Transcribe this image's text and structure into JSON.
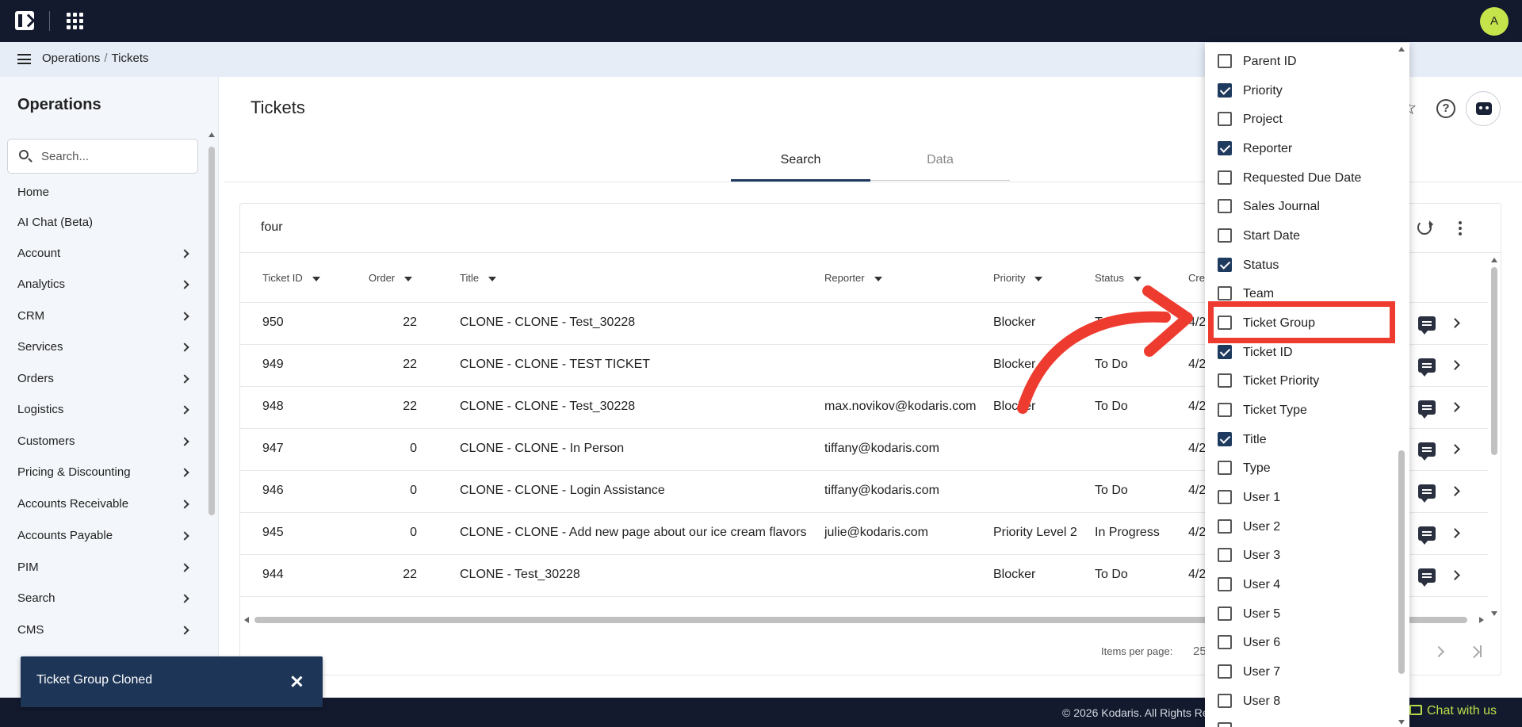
{
  "topbar": {
    "avatar_initial": "A"
  },
  "breadcrumb": {
    "section": "Operations",
    "separator": "/",
    "page": "Tickets"
  },
  "sidebar": {
    "title": "Operations",
    "search_placeholder": "Search...",
    "items": [
      {
        "label": "Home",
        "has_children": false
      },
      {
        "label": "AI Chat (Beta)",
        "has_children": false
      },
      {
        "label": "Account",
        "has_children": true
      },
      {
        "label": "Analytics",
        "has_children": true
      },
      {
        "label": "CRM",
        "has_children": true
      },
      {
        "label": "Services",
        "has_children": true
      },
      {
        "label": "Orders",
        "has_children": true
      },
      {
        "label": "Logistics",
        "has_children": true
      },
      {
        "label": "Customers",
        "has_children": true
      },
      {
        "label": "Pricing & Discounting",
        "has_children": true
      },
      {
        "label": "Accounts Receivable",
        "has_children": true
      },
      {
        "label": "Accounts Payable",
        "has_children": true
      },
      {
        "label": "PIM",
        "has_children": true
      },
      {
        "label": "Search",
        "has_children": true
      },
      {
        "label": "CMS",
        "has_children": true
      }
    ]
  },
  "main": {
    "title": "Tickets",
    "tabs": [
      {
        "label": "Search",
        "active": true
      },
      {
        "label": "Data",
        "active": false
      }
    ],
    "help_glyph": "?",
    "search_value": "four"
  },
  "table": {
    "columns": [
      {
        "label": "Ticket ID"
      },
      {
        "label": "Order"
      },
      {
        "label": "Title"
      },
      {
        "label": "Reporter"
      },
      {
        "label": "Priority"
      },
      {
        "label": "Status"
      },
      {
        "label": "Cre"
      }
    ],
    "rows": [
      {
        "ticket_id": "950",
        "order": "22",
        "title": "CLONE - CLONE - Test_30228",
        "reporter": "",
        "priority": "Blocker",
        "status": "To",
        "created": "4/2"
      },
      {
        "ticket_id": "949",
        "order": "22",
        "title": "CLONE - CLONE - TEST TICKET",
        "reporter": "",
        "priority": "Blocker",
        "status": "To Do",
        "created": "4/2"
      },
      {
        "ticket_id": "948",
        "order": "22",
        "title": "CLONE - CLONE - Test_30228",
        "reporter": "max.novikov@kodaris.com",
        "priority": "Blocker",
        "status": "To Do",
        "created": "4/2"
      },
      {
        "ticket_id": "947",
        "order": "0",
        "title": "CLONE - CLONE - In Person",
        "reporter": "tiffany@kodaris.com",
        "priority": "",
        "status": "",
        "created": "4/2"
      },
      {
        "ticket_id": "946",
        "order": "0",
        "title": "CLONE - CLONE - Login Assistance",
        "reporter": "tiffany@kodaris.com",
        "priority": "",
        "status": "To Do",
        "created": "4/2"
      },
      {
        "ticket_id": "945",
        "order": "0",
        "title": "CLONE - CLONE - Add new page about our ice cream flavors",
        "reporter": "julie@kodaris.com",
        "priority": "Priority Level 2",
        "status": "In Progress",
        "created": "4/2"
      },
      {
        "ticket_id": "944",
        "order": "22",
        "title": "CLONE - Test_30228",
        "reporter": "",
        "priority": "Blocker",
        "status": "To Do",
        "created": "4/2"
      }
    ]
  },
  "pagination": {
    "items_per_page_label": "Items per page:",
    "items_per_page_value": "25"
  },
  "column_picker": {
    "options": [
      {
        "label": "Parent ID",
        "checked": false
      },
      {
        "label": "Priority",
        "checked": true
      },
      {
        "label": "Project",
        "checked": false
      },
      {
        "label": "Reporter",
        "checked": true
      },
      {
        "label": "Requested Due Date",
        "checked": false
      },
      {
        "label": "Sales Journal",
        "checked": false
      },
      {
        "label": "Start Date",
        "checked": false
      },
      {
        "label": "Status",
        "checked": true
      },
      {
        "label": "Team",
        "checked": false
      },
      {
        "label": "Ticket Group",
        "checked": false
      },
      {
        "label": "Ticket ID",
        "checked": true
      },
      {
        "label": "Ticket Priority",
        "checked": false
      },
      {
        "label": "Ticket Type",
        "checked": false
      },
      {
        "label": "Title",
        "checked": true
      },
      {
        "label": "Type",
        "checked": false
      },
      {
        "label": "User 1",
        "checked": false
      },
      {
        "label": "User 2",
        "checked": false
      },
      {
        "label": "User 3",
        "checked": false
      },
      {
        "label": "User 4",
        "checked": false
      },
      {
        "label": "User 5",
        "checked": false
      },
      {
        "label": "User 6",
        "checked": false
      },
      {
        "label": "User 7",
        "checked": false
      },
      {
        "label": "User 8",
        "checked": false
      }
    ],
    "highlighted": "Ticket Group"
  },
  "toast": {
    "message": "Ticket Group Cloned"
  },
  "footer": {
    "copyright": "© 2026 Kodaris. All Rights Re",
    "chat_label": "Chat with us"
  },
  "colors": {
    "topbar": "#131a2e",
    "accent": "#1f3a5f",
    "annotation_red": "#ee3b2f",
    "avatar": "#c5e34a",
    "chat": "#b9e04a"
  }
}
